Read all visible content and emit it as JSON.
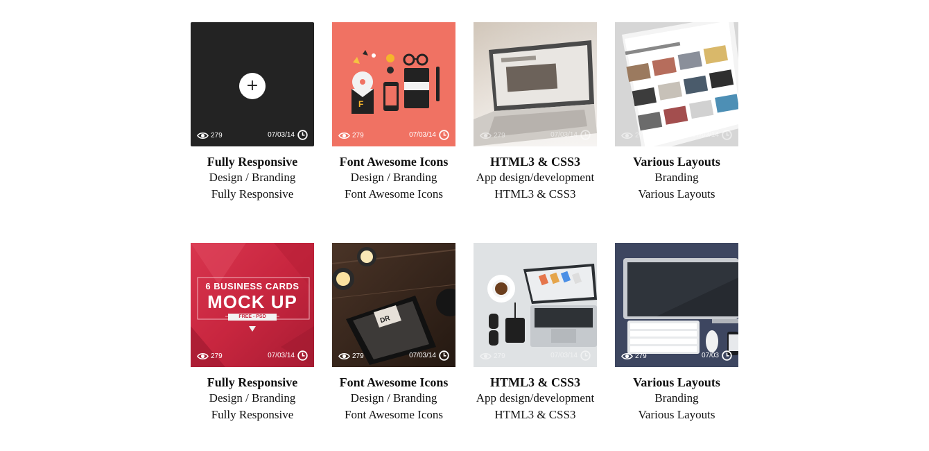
{
  "cards": [
    {
      "title": "Fully Responsive",
      "category": "Design / Branding",
      "subtitle": "Fully Responsive",
      "views": "279",
      "date": "07/03/14",
      "image": "dark-overlay"
    },
    {
      "title": "Font Awesome Icons",
      "category": "Design / Branding",
      "subtitle": "Font Awesome Icons",
      "views": "279",
      "date": "07/03/14",
      "image": "stationery-coral"
    },
    {
      "title": "HTML3 & CSS3",
      "category": "App design/development",
      "subtitle": "HTML3 & CSS3",
      "views": "279",
      "date": "07/03/14",
      "image": "laptop-desk"
    },
    {
      "title": "Various Layouts",
      "category": "Branding",
      "subtitle": "Various Layouts",
      "views": "279",
      "date": "07/03/14",
      "image": "tablet-layouts"
    },
    {
      "title": "Fully Responsive",
      "category": "Design / Branding",
      "subtitle": "Fully Responsive",
      "views": "279",
      "date": "07/03/14",
      "image": "business-cards",
      "image_text": {
        "line1": "6 BUSINESS CARDS",
        "line2": "MOCK UP",
        "line3": "FREE - PSD"
      }
    },
    {
      "title": "Font Awesome Icons",
      "category": "Design / Branding",
      "subtitle": "Font Awesome Icons",
      "views": "279",
      "date": "07/03/14",
      "image": "tablet-candles"
    },
    {
      "title": "HTML3 & CSS3",
      "category": "App design/development",
      "subtitle": "HTML3 & CSS3",
      "views": "279",
      "date": "07/03/14",
      "image": "flat-laptop-coffee"
    },
    {
      "title": "Various Layouts",
      "category": "Branding",
      "subtitle": "Various Layouts",
      "views": "279",
      "date": "07/03",
      "image": "flat-imac-keyboard"
    }
  ],
  "overlay_icon": "plus-icon",
  "overlay_symbol": "+",
  "colors": {
    "dark_overlay": "#232323",
    "coral": "#f07263",
    "crimson": "#c8263f",
    "navy": "#3d4660"
  }
}
